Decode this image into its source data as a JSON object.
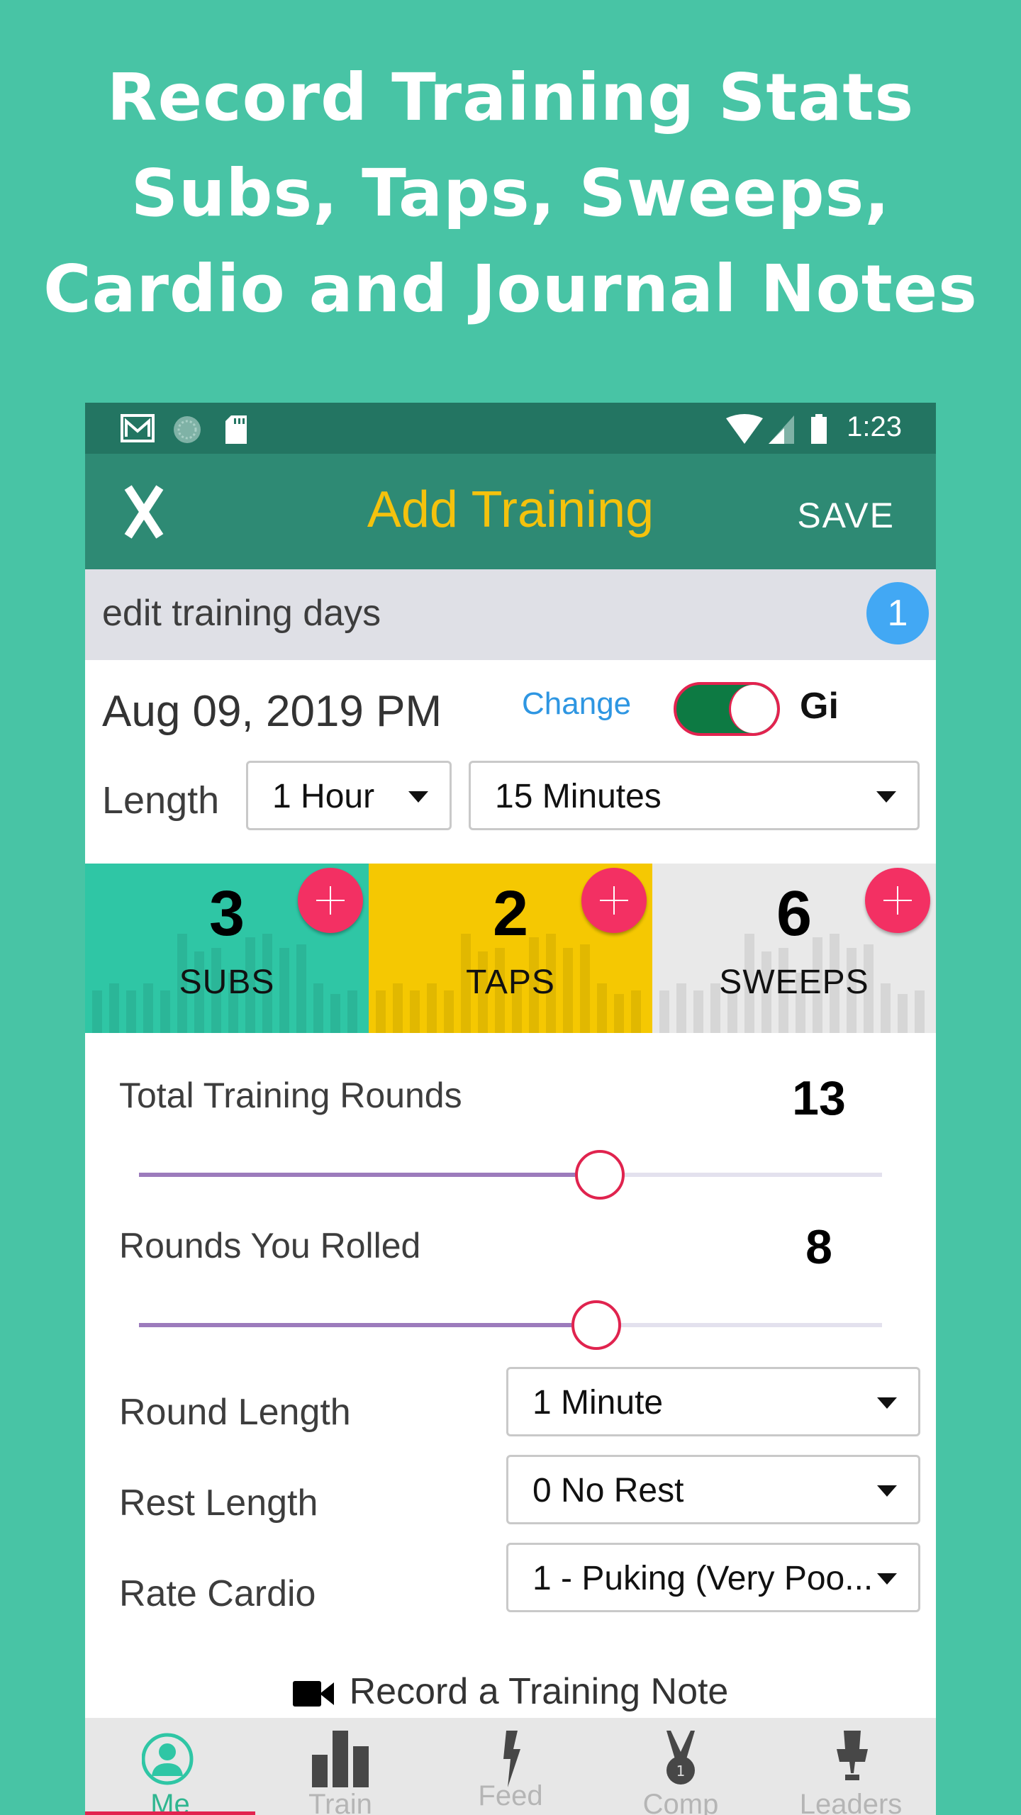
{
  "promo": {
    "lines": [
      "Record Training Stats",
      "Subs, Taps, Sweeps,",
      "Cardio and Journal Notes"
    ]
  },
  "status_bar": {
    "time": "1:23",
    "icons": [
      "gmail-icon",
      "sync-icon",
      "sd-card-icon",
      "wifi-icon",
      "signal-icon",
      "battery-icon"
    ]
  },
  "app_bar": {
    "title": "Add Training",
    "save_label": "SAVE",
    "close_icon": "close-icon",
    "title_color": "#f4c20d"
  },
  "edit_bar": {
    "label": "edit training days",
    "badge": "1"
  },
  "session": {
    "date": "Aug 09, 2019 PM",
    "change_label": "Change",
    "gi_label": "Gi",
    "gi_enabled": true,
    "length_label": "Length",
    "hours": "1 Hour",
    "minutes": "15 Minutes"
  },
  "stats": [
    {
      "value": "3",
      "label": "SUBS",
      "color": "#2fc6a5"
    },
    {
      "value": "2",
      "label": "TAPS",
      "color": "#f5c802"
    },
    {
      "value": "6",
      "label": "SWEEPS",
      "color": "#e9e9e9"
    }
  ],
  "sliders": [
    {
      "label": "Total Training Rounds",
      "value": "13",
      "fraction": 0.62
    },
    {
      "label": "Rounds You Rolled",
      "value": "8",
      "fraction": 0.615
    }
  ],
  "fields": [
    {
      "label": "Round Length",
      "value": "1 Minute"
    },
    {
      "label": "Rest Length",
      "value": "0 No Rest"
    },
    {
      "label": "Rate Cardio",
      "value": "1 - Puking (Very Poo..."
    }
  ],
  "record_note": {
    "label": "Record a Training Note",
    "icon": "video-camera-icon"
  },
  "bottom_nav": {
    "items": [
      {
        "label": "Me",
        "icon": "profile-icon",
        "active": true
      },
      {
        "label": "Train",
        "icon": "bar-chart-icon",
        "active": false
      },
      {
        "label": "Feed",
        "icon": "lightning-icon",
        "active": false
      },
      {
        "label": "Comp",
        "icon": "medal-icon",
        "active": false
      },
      {
        "label": "Leaders",
        "icon": "trophy-icon",
        "active": false
      }
    ]
  }
}
